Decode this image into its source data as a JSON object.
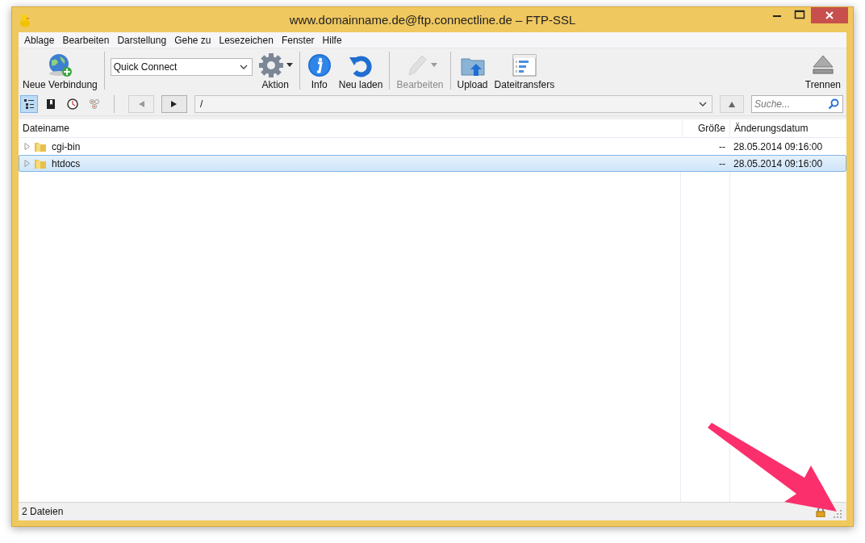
{
  "window": {
    "title": "www.domainname.de@ftp.connectline.de – FTP-SSL"
  },
  "menu": [
    "Ablage",
    "Bearbeiten",
    "Darstellung",
    "Gehe zu",
    "Lesezeichen",
    "Fenster",
    "Hilfe"
  ],
  "toolbar": {
    "groups": [
      [
        {
          "kind": "button",
          "label": "Neue Verbindung",
          "disabled": false,
          "has_menu": false
        }
      ],
      [
        {
          "kind": "combo",
          "value": "Quick Connect"
        },
        {
          "kind": "button",
          "label": "Aktion",
          "disabled": false,
          "has_menu": true
        }
      ],
      [
        {
          "kind": "button",
          "label": "Info",
          "disabled": false,
          "has_menu": false
        },
        {
          "kind": "button",
          "label": "Neu laden",
          "disabled": false,
          "has_menu": false
        }
      ],
      [
        {
          "kind": "button",
          "label": "Bearbeiten",
          "disabled": true,
          "has_menu": true
        }
      ],
      [
        {
          "kind": "button",
          "label": "Upload",
          "disabled": false,
          "has_menu": false
        },
        {
          "kind": "button",
          "label": "Dateitransfers",
          "disabled": false,
          "has_menu": false
        }
      ]
    ],
    "right": [
      {
        "kind": "button",
        "label": "Trennen",
        "disabled": false,
        "has_menu": false
      }
    ]
  },
  "view_modes": [
    {
      "selected": true
    },
    {
      "selected": false
    },
    {
      "selected": false
    },
    {
      "selected": false
    }
  ],
  "navigation": {
    "back_disabled": true,
    "forward_disabled": false,
    "path": "/",
    "search": {
      "placeholder": "Suche..."
    }
  },
  "table": {
    "columns": [
      "Dateiname",
      "Größe",
      "Änderungsdatum"
    ],
    "rows": [
      {
        "name": "cgi-bin",
        "size": "--",
        "modified": "28.05.2014 09:16:00",
        "selected": false
      },
      {
        "name": "htdocs",
        "size": "--",
        "modified": "28.05.2014 09:16:00",
        "selected": true
      }
    ]
  },
  "status_bar": {
    "text": "2 Dateien",
    "secure": true
  }
}
